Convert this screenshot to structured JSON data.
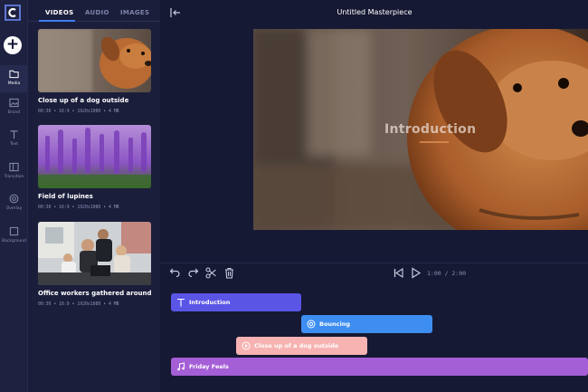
{
  "app": {
    "title": "Untitled Masterpiece"
  },
  "rail": {
    "items": [
      {
        "label": "Media"
      },
      {
        "label": "Brand"
      },
      {
        "label": "Text"
      },
      {
        "label": "Transition"
      },
      {
        "label": "Overlay"
      },
      {
        "label": "Background"
      }
    ]
  },
  "panel": {
    "tabs": [
      "VIDEOS",
      "AUDIO",
      "IMAGES"
    ],
    "cards": [
      {
        "title": "Close up of a dog outside",
        "meta": "00:30 • 16:9 • 1920x1080 • 4 MB"
      },
      {
        "title": "Field of lupines",
        "meta": "00:30 • 16:9 • 1920x1080 • 4 MB"
      },
      {
        "title": "Office workers gathered around...",
        "meta": "00:30 • 16:9 • 1920x1080 • 4 MB"
      }
    ]
  },
  "preview": {
    "overlay_text": "Introduction"
  },
  "toolbar": {
    "time": "1:00 / 2:00"
  },
  "timeline": {
    "clips": [
      {
        "label": "Introduction",
        "color": "#5b55e6"
      },
      {
        "label": "Bouncing",
        "color": "#3d8ef0"
      },
      {
        "label": "Close up of a dog outside",
        "color": "#f6b3b1"
      },
      {
        "label": "Friday Feels",
        "color": "#a45ed6"
      }
    ]
  },
  "colors": {
    "accent": "#3f7cf0",
    "background": "#161933"
  }
}
